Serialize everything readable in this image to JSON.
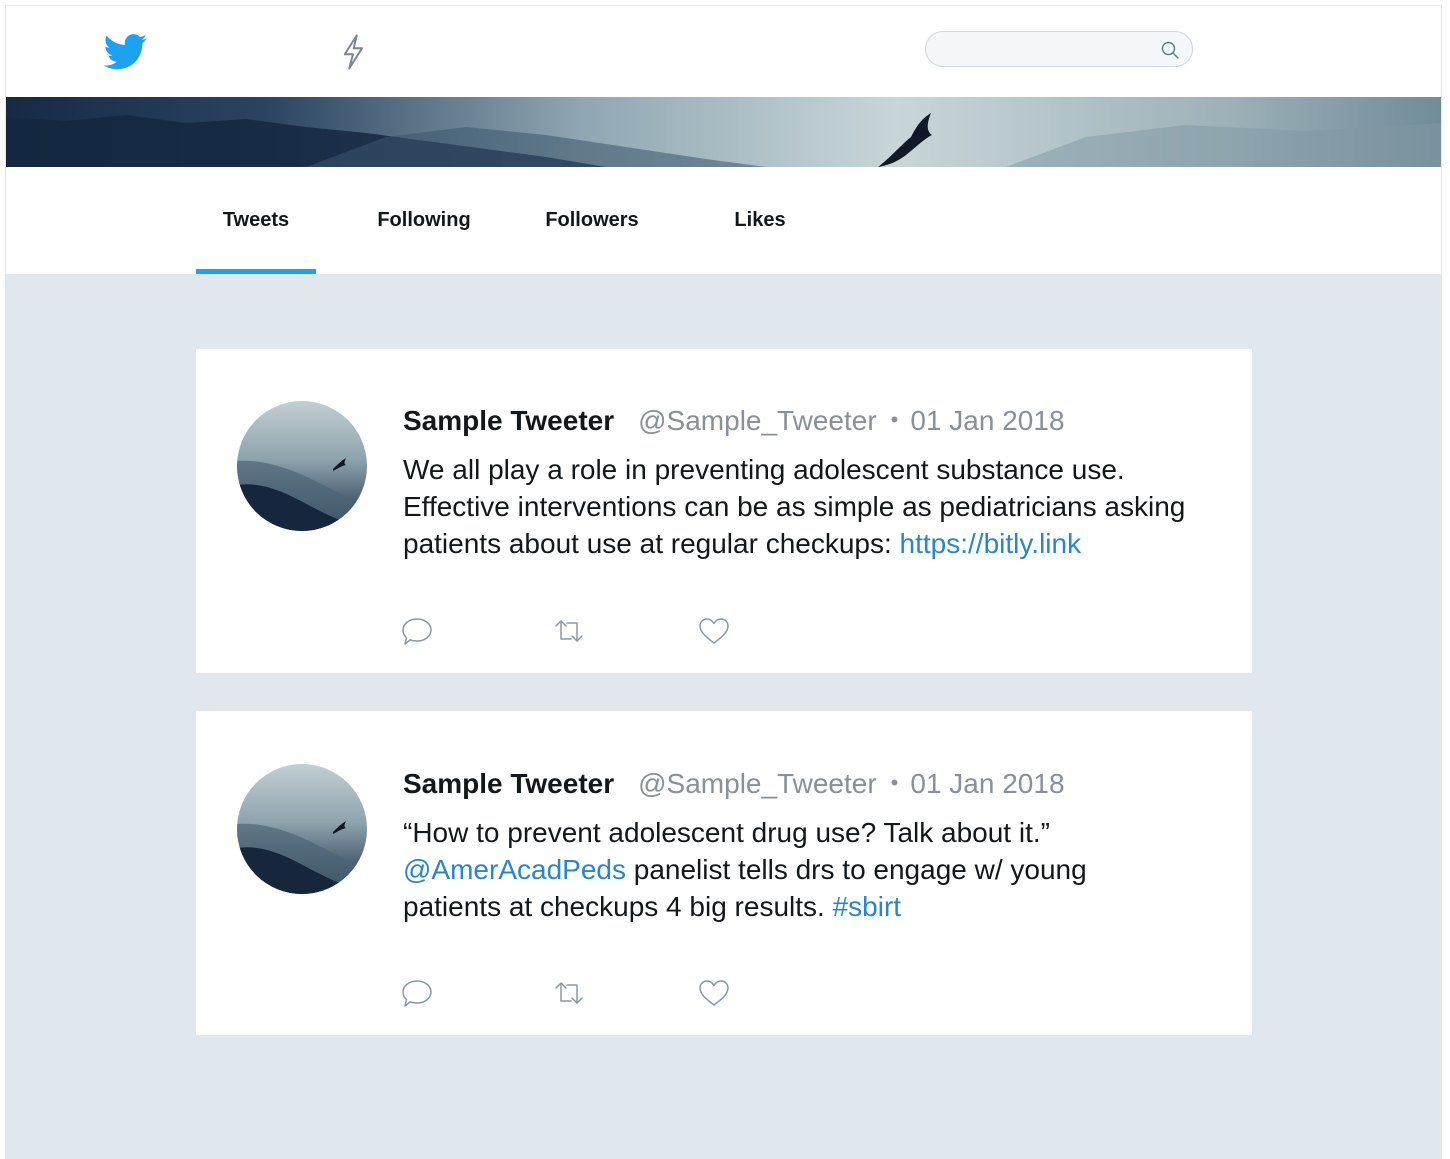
{
  "colors": {
    "accent": "#1da1f2",
    "link": "#2a86c7",
    "background": "#e1e8ed"
  },
  "nav": {
    "logo_icon": "twitter-bird-icon",
    "moments_icon": "lightning-bolt-icon",
    "search": {
      "value": "",
      "placeholder": "",
      "icon": "search-icon"
    }
  },
  "tabs": [
    {
      "label": "Tweets",
      "active": true
    },
    {
      "label": "Following",
      "active": false
    },
    {
      "label": "Followers",
      "active": false
    },
    {
      "label": "Likes",
      "active": false
    }
  ],
  "tweets": [
    {
      "name": "Sample Tweeter",
      "handle": "@Sample_Tweeter",
      "separator": "•",
      "date": "01 Jan 2018",
      "text_1": "We all play a role in preventing adolescent substance use. Effective interventions can be as simple as pediatricians asking patients about use at regular checkups: ",
      "link": "https://bitly.link"
    },
    {
      "name": "Sample Tweeter",
      "handle": "@Sample_Tweeter",
      "separator": "•",
      "date": "01 Jan 2018",
      "text_1": "“How to prevent adolescent drug use? Talk about it.” ",
      "mention": "@AmerAcadPeds",
      "text_2": " panelist tells drs to engage w/ young patients at checkups 4 big results. ",
      "hashtag": "#sbirt"
    }
  ],
  "actions": [
    "reply-icon",
    "retweet-icon",
    "like-icon"
  ]
}
